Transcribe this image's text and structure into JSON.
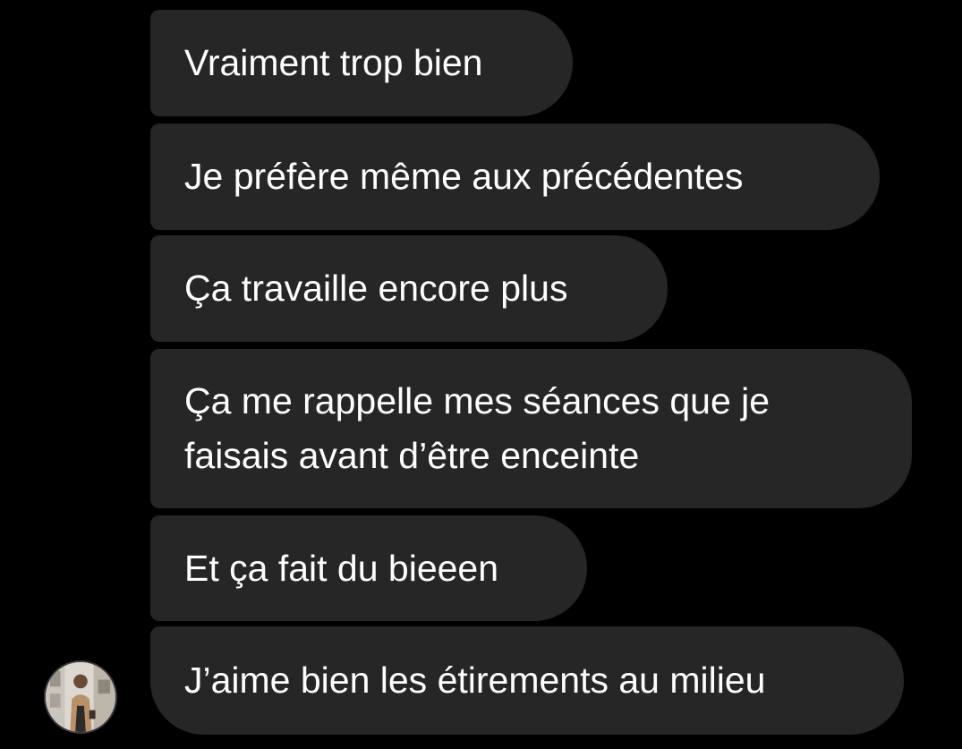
{
  "messages": [
    {
      "text": "Vraiment trop bien"
    },
    {
      "text": "Je préfère même aux précédentes"
    },
    {
      "text": "Ça travaille encore plus"
    },
    {
      "lines": [
        "Ça me rappelle mes séances que je",
        "faisais avant d’être enceinte"
      ]
    },
    {
      "text": "Et ça fait du bieeen"
    },
    {
      "text": "J’aime bien les étirements au milieu"
    }
  ],
  "colors": {
    "background": "#000000",
    "bubble": "#262626",
    "text": "#ffffff"
  },
  "avatar": {
    "icon": "user-photo-avatar"
  }
}
